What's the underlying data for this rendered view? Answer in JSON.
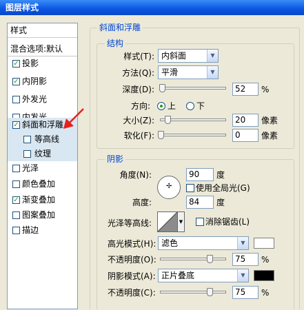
{
  "window": {
    "title": "图层样式"
  },
  "left_panel": {
    "header": "样式",
    "blend_options": "混合选项:默认",
    "items": [
      {
        "label": "投影",
        "checked": true
      },
      {
        "label": "内阴影",
        "checked": true
      },
      {
        "label": "外发光",
        "checked": false
      },
      {
        "label": "内发光",
        "checked": false
      },
      {
        "label": "斜面和浮雕",
        "checked": true
      },
      {
        "label": "等高线",
        "checked": false
      },
      {
        "label": "纹理",
        "checked": false
      },
      {
        "label": "光泽",
        "checked": false
      },
      {
        "label": "颜色叠加",
        "checked": false
      },
      {
        "label": "渐变叠加",
        "checked": true
      },
      {
        "label": "图案叠加",
        "checked": false
      },
      {
        "label": "描边",
        "checked": false
      }
    ]
  },
  "bevel": {
    "title": "斜面和浮雕",
    "structure": {
      "title": "结构",
      "style_label": "样式(T):",
      "style_value": "内斜面",
      "method_label": "方法(Q):",
      "method_value": "平滑",
      "depth_label": "深度(D):",
      "depth_value": "52",
      "depth_unit": "%",
      "direction_label": "方向:",
      "direction_up": "上",
      "direction_down": "下",
      "size_label": "大小(Z):",
      "size_value": "20",
      "size_unit": "像素",
      "soften_label": "软化(F):",
      "soften_value": "0",
      "soften_unit": "像素"
    },
    "shading": {
      "title": "阴影",
      "angle_label": "角度(N):",
      "angle_value": "90",
      "angle_unit": "度",
      "global_light_label": "使用全局光(G)",
      "altitude_label": "高度:",
      "altitude_value": "84",
      "altitude_unit": "度",
      "gloss_label": "光泽等高线:",
      "antialias_label": "消除锯齿(L)",
      "highlight_mode_label": "高光模式(H):",
      "highlight_mode_value": "滤色",
      "highlight_color": "#ffffff",
      "highlight_opacity_label": "不透明度(O):",
      "highlight_opacity_value": "75",
      "highlight_opacity_unit": "%",
      "shadow_mode_label": "阴影模式(A):",
      "shadow_mode_value": "正片叠底",
      "shadow_color": "#000000",
      "shadow_opacity_label": "不透明度(C):",
      "shadow_opacity_value": "75",
      "shadow_opacity_unit": "%"
    }
  },
  "colors": {
    "accent": "#0046d5",
    "selection": "#d9e7f2",
    "check": "#21a121"
  }
}
